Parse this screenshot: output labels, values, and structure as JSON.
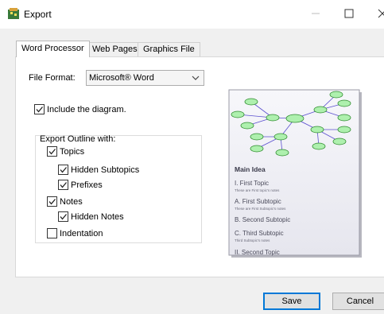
{
  "window": {
    "title": "Export",
    "icon": "mindmap-app-icon"
  },
  "tabs": [
    {
      "label": "Word Processor",
      "active": true
    },
    {
      "label": "Web Pages",
      "active": false
    },
    {
      "label": "Graphics File",
      "active": false
    }
  ],
  "file_format": {
    "label": "File Format:",
    "value": "Microsoft® Word"
  },
  "include_diagram": {
    "label": "Include the diagram.",
    "checked": true
  },
  "outline": {
    "label": "Export Outline with:",
    "options": [
      {
        "label": "Topics",
        "checked": true
      },
      {
        "label": "Hidden Subtopics",
        "checked": true
      },
      {
        "label": "Prefixes",
        "checked": true
      },
      {
        "label": "Notes",
        "checked": true
      },
      {
        "label": "Hidden Notes",
        "checked": true
      },
      {
        "label": "Indentation",
        "checked": false
      }
    ]
  },
  "preview": {
    "heading": "Main Idea",
    "items": [
      {
        "title": "I. First Topic",
        "note": "These are First topic's notes"
      },
      {
        "title": "A. First Subtopic",
        "note": "These are First Subtopic's notes"
      },
      {
        "title": "B. Second Subtopic",
        "note": ""
      },
      {
        "title": "C. Third Subtopic",
        "note": "Third Subtopic's notes"
      },
      {
        "title": "II. Second Topic",
        "note": ""
      }
    ],
    "colors": {
      "node_fill": "#aef0ae",
      "node_stroke": "#2e8b2e",
      "link": "#5a4fcf",
      "page": "#ececf4"
    }
  },
  "buttons": {
    "save": "Save",
    "cancel": "Cancel"
  }
}
